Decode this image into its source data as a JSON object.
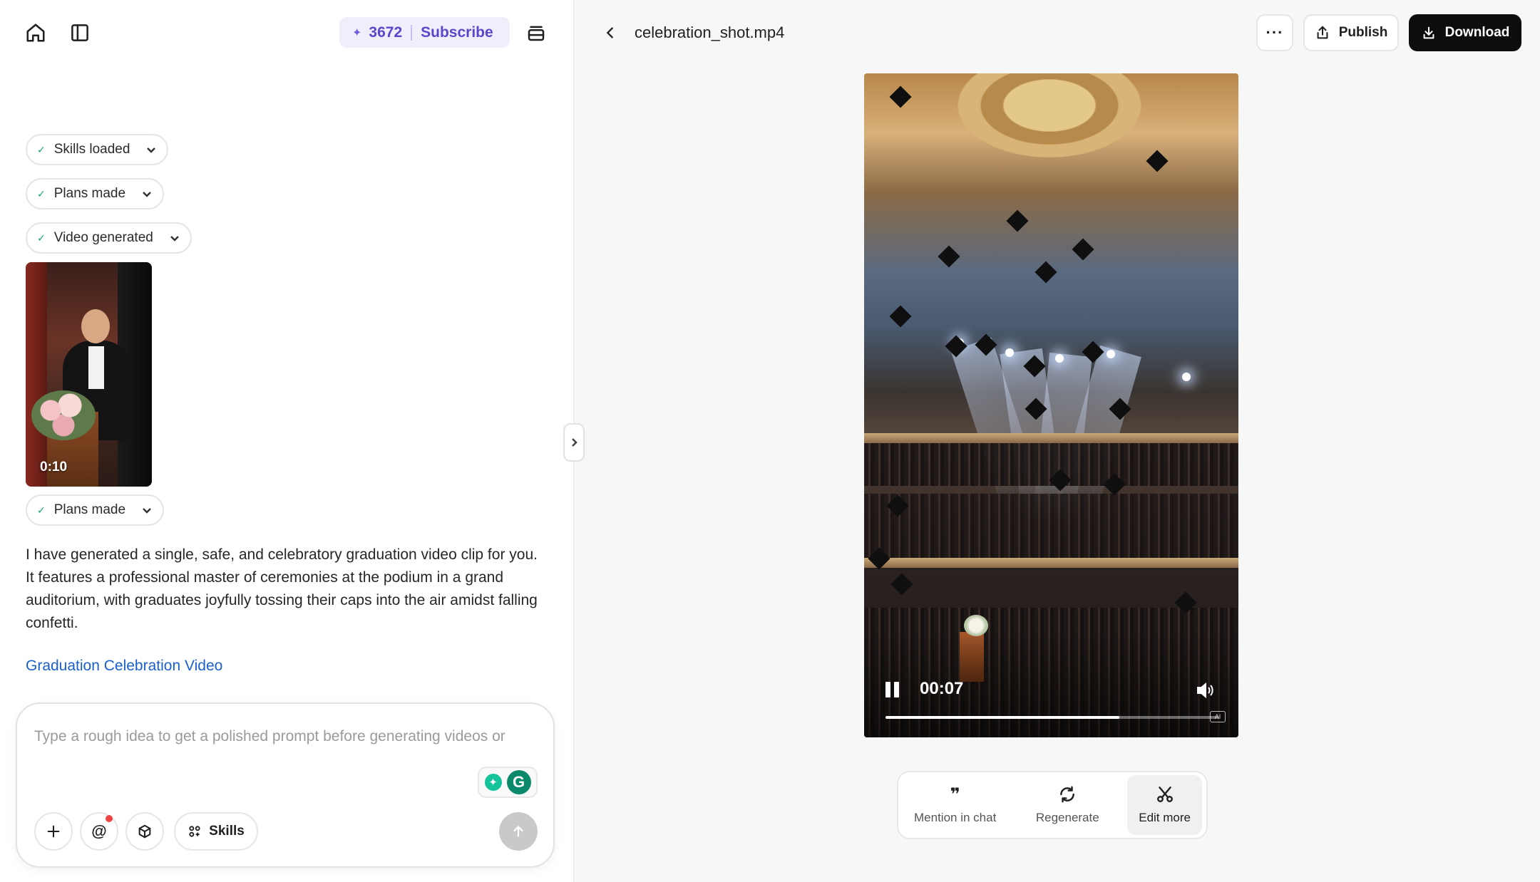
{
  "header": {
    "credits": "3672",
    "subscribe_label": "Subscribe"
  },
  "steps": [
    {
      "label": "Skills loaded"
    },
    {
      "label": "Plans made"
    },
    {
      "label": "Video generated"
    },
    {
      "label": "Plans made"
    }
  ],
  "thumbnail": {
    "duration": "0:10"
  },
  "message": {
    "text": "I have generated a single, safe, and celebratory graduation video clip for you. It features a professional master of ceremonies at the podium in a grand auditorium, with graduates joyfully tossing their caps into the air amidst falling confetti.",
    "link_label": "Graduation Celebration Video"
  },
  "composer": {
    "placeholder": "Type a rough idea to get a polished prompt before generating videos or",
    "skills_label": "Skills"
  },
  "viewer": {
    "file_name": "celebration_shot.mp4",
    "publish_label": "Publish",
    "download_label": "Download",
    "more_label": "···",
    "current_time": "00:07",
    "progress": 0.7,
    "actions": [
      {
        "label": "Mention in chat",
        "icon": "quote-icon"
      },
      {
        "label": "Regenerate",
        "icon": "refresh-icon"
      },
      {
        "label": "Edit more",
        "icon": "scissors-icon"
      }
    ]
  },
  "colors": {
    "accent": "#5b45c9",
    "link": "#1a5fd0",
    "primary_button": "#0d0d0d",
    "success_check": "#1aa37a"
  }
}
